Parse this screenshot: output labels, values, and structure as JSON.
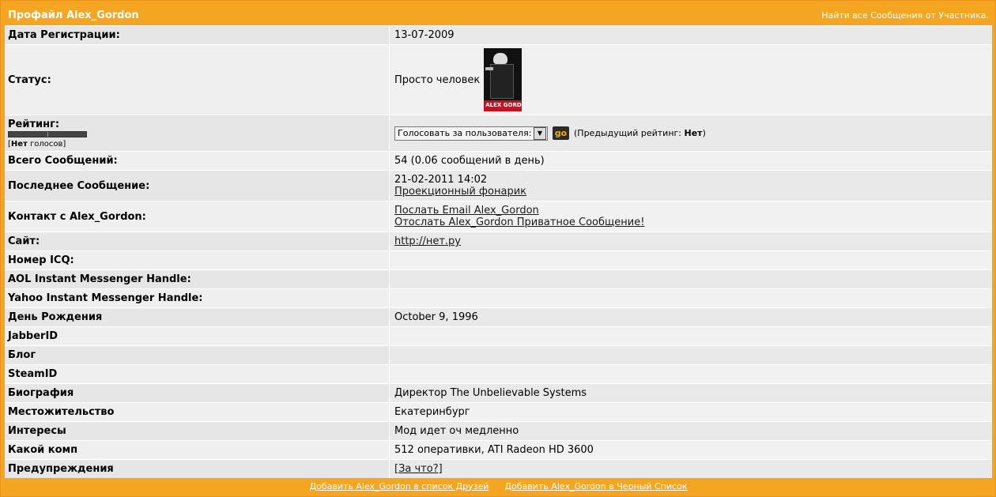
{
  "header": {
    "title": "Профайл Alex_Gordon",
    "find_link": "Найти все Сообщения от Участника."
  },
  "rows": {
    "reg_date": {
      "label": "Дата Регистрации:",
      "value": "13-07-2009"
    },
    "status": {
      "label": "Статус:",
      "value": "Просто человек",
      "avatar_text": "ALEX GORDON"
    },
    "rating": {
      "label": "Рейтинг:",
      "no_votes_prefix": "[",
      "no_votes_bold": "Нет",
      "no_votes_suffix": " голосов]",
      "select_value": "Голосовать за пользователя:",
      "go_label": "go",
      "prev_prefix": "(Предыдущий рейтинг: ",
      "prev_bold": "Нет",
      "prev_suffix": ")"
    },
    "total_posts": {
      "label": "Всего Сообщений:",
      "value": "54 (0.06 сообщений в день)"
    },
    "last_post": {
      "label": "Последнее Сообщение:",
      "date": "21-02-2011 14:02",
      "link": "Проекционный фонарик"
    },
    "contact": {
      "label": "Контакт с Alex_Gordon:",
      "email_link": "Послать Email Alex_Gordon",
      "pm_link": "Отослать Alex_Gordon Приватное Сообщение!"
    },
    "site": {
      "label": "Сайт:",
      "link": "http://нет.ру"
    },
    "icq": {
      "label": "Номер ICQ:",
      "value": ""
    },
    "aol": {
      "label": "AOL Instant Messenger Handle:",
      "value": ""
    },
    "yahoo": {
      "label": "Yahoo Instant Messenger Handle:",
      "value": ""
    },
    "birthday": {
      "label": "День Рождения",
      "value": "October 9, 1996"
    },
    "jabber": {
      "label": "JabberID",
      "value": ""
    },
    "blog": {
      "label": "Блог",
      "value": ""
    },
    "steam": {
      "label": "SteamID",
      "value": ""
    },
    "bio": {
      "label": "Биография",
      "value": "Директор The Unbelievable Systems"
    },
    "location": {
      "label": "Местожительство",
      "value": "Екатеринбург"
    },
    "interests": {
      "label": "Интересы",
      "value": "Мод идет оч медленно"
    },
    "pc": {
      "label": "Какой комп",
      "value": "512 оперативки, ATI Radeon HD 3600"
    },
    "warnings": {
      "label": "Предупреждения",
      "link": "[За что?]"
    }
  },
  "footer": {
    "add_friend": "Добавить Alex_Gordon в список Друзей",
    "add_blacklist": "Добавить Alex_Gordon в Черный Список"
  }
}
